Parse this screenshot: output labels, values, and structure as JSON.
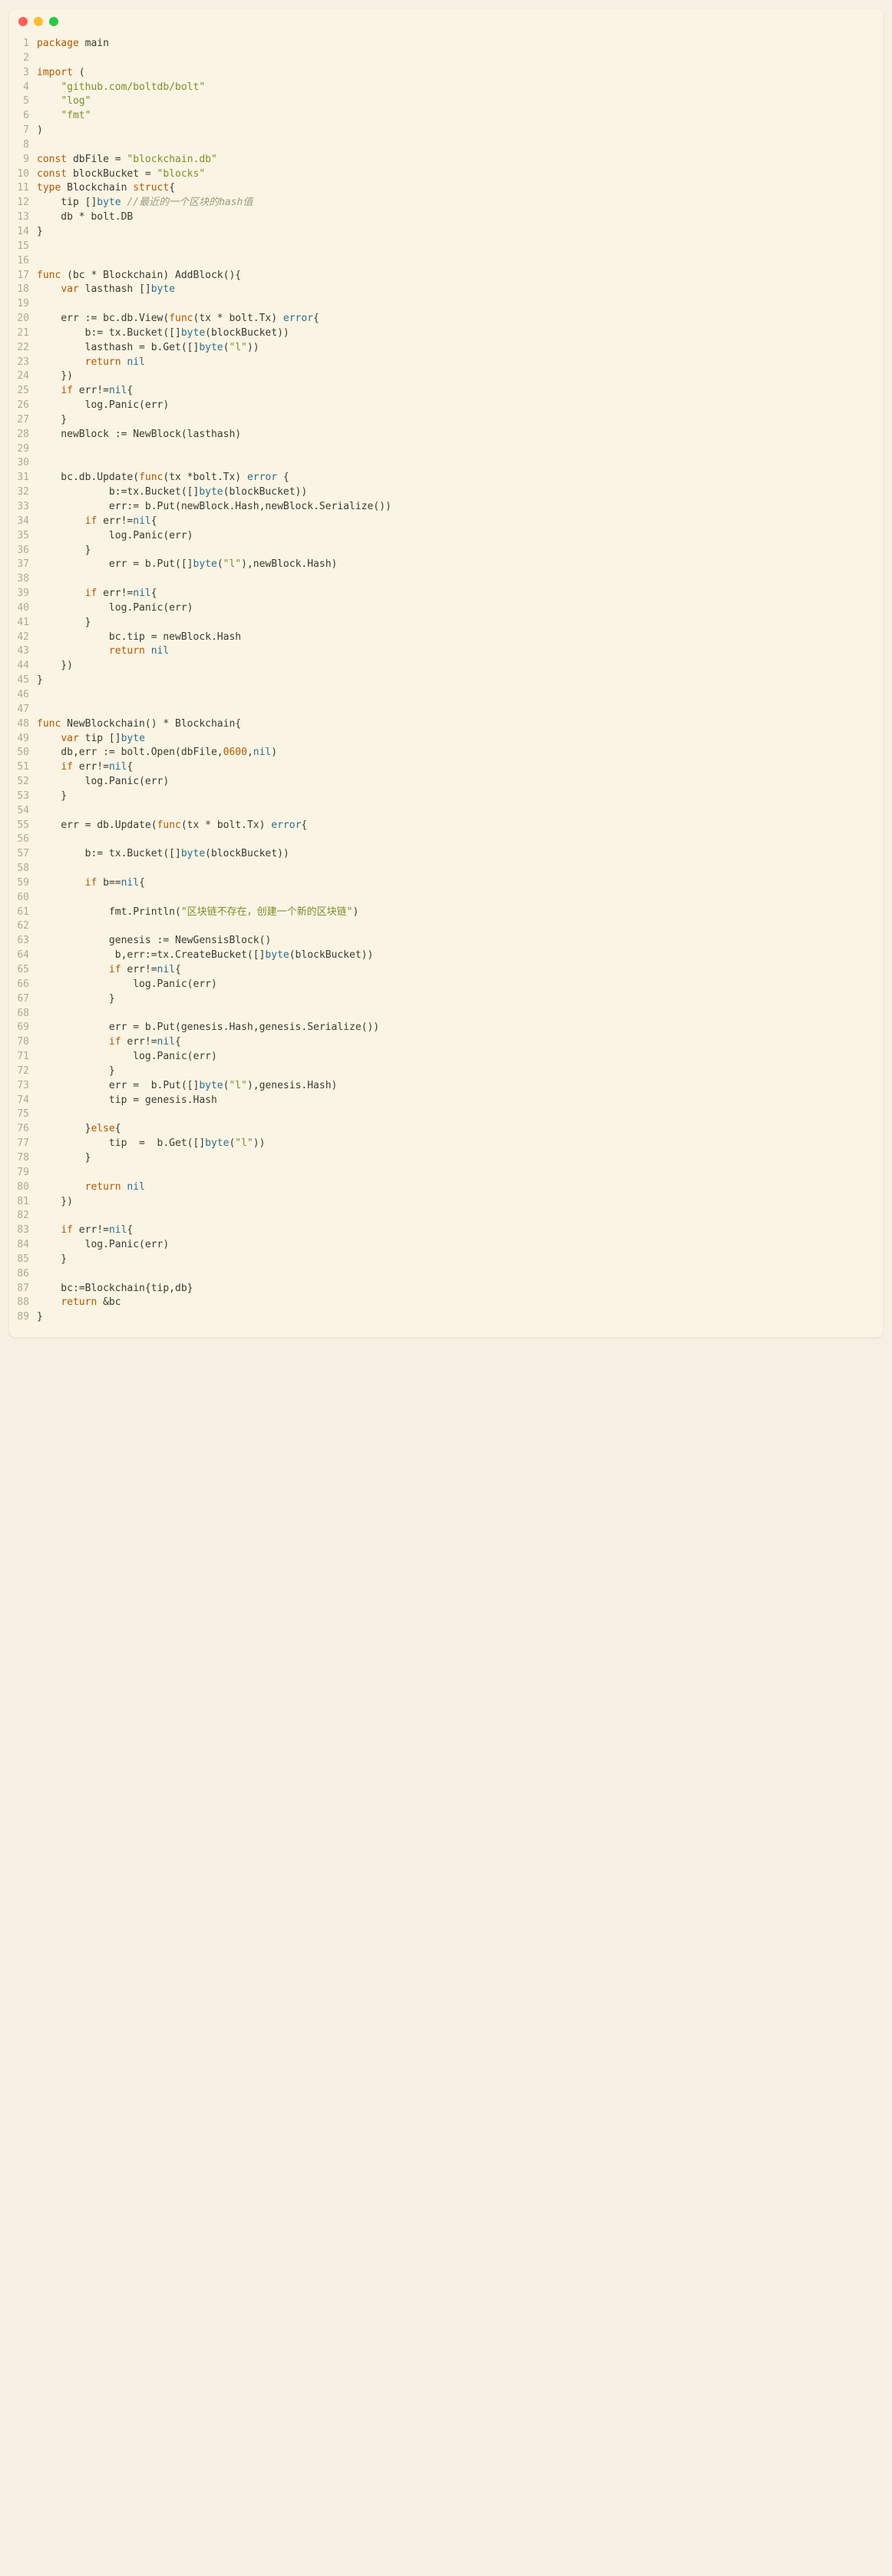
{
  "window": {
    "dots": [
      "red",
      "yellow",
      "green"
    ]
  },
  "code": {
    "lines": [
      {
        "n": 1,
        "t": [
          [
            "kw",
            "package"
          ],
          [
            "id",
            " main"
          ]
        ]
      },
      {
        "n": 2,
        "t": [
          [
            "id",
            ""
          ]
        ]
      },
      {
        "n": 3,
        "t": [
          [
            "kw",
            "import"
          ],
          [
            "id",
            " ("
          ]
        ]
      },
      {
        "n": 4,
        "t": [
          [
            "id",
            "    "
          ],
          [
            "str",
            "\"github.com/boltdb/bolt\""
          ]
        ]
      },
      {
        "n": 5,
        "t": [
          [
            "id",
            "    "
          ],
          [
            "str",
            "\"log\""
          ]
        ]
      },
      {
        "n": 6,
        "t": [
          [
            "id",
            "    "
          ],
          [
            "str",
            "\"fmt\""
          ]
        ]
      },
      {
        "n": 7,
        "t": [
          [
            "id",
            ")"
          ]
        ]
      },
      {
        "n": 8,
        "t": [
          [
            "id",
            ""
          ]
        ]
      },
      {
        "n": 9,
        "t": [
          [
            "kw",
            "const"
          ],
          [
            "id",
            " dbFile = "
          ],
          [
            "str",
            "\"blockchain.db\""
          ]
        ]
      },
      {
        "n": 10,
        "t": [
          [
            "kw",
            "const"
          ],
          [
            "id",
            " blockBucket = "
          ],
          [
            "str",
            "\"blocks\""
          ]
        ]
      },
      {
        "n": 11,
        "t": [
          [
            "kw",
            "type"
          ],
          [
            "id",
            " Blockchain "
          ],
          [
            "kw",
            "struct"
          ],
          [
            "id",
            "{"
          ]
        ]
      },
      {
        "n": 12,
        "t": [
          [
            "id",
            "    tip []"
          ],
          [
            "typ",
            "byte"
          ],
          [
            "id",
            " "
          ],
          [
            "cmt",
            "//最近的一个区块的hash值"
          ]
        ]
      },
      {
        "n": 13,
        "t": [
          [
            "id",
            "    db * bolt.DB"
          ]
        ]
      },
      {
        "n": 14,
        "t": [
          [
            "id",
            "}"
          ]
        ]
      },
      {
        "n": 15,
        "t": [
          [
            "id",
            ""
          ]
        ]
      },
      {
        "n": 16,
        "t": [
          [
            "id",
            ""
          ]
        ]
      },
      {
        "n": 17,
        "t": [
          [
            "kw",
            "func"
          ],
          [
            "id",
            " (bc * Blockchain) AddBlock(){"
          ]
        ]
      },
      {
        "n": 18,
        "t": [
          [
            "id",
            "    "
          ],
          [
            "kw",
            "var"
          ],
          [
            "id",
            " lasthash []"
          ],
          [
            "typ",
            "byte"
          ]
        ]
      },
      {
        "n": 19,
        "t": [
          [
            "id",
            ""
          ]
        ]
      },
      {
        "n": 20,
        "t": [
          [
            "id",
            "    err := bc.db.View("
          ],
          [
            "kw",
            "func"
          ],
          [
            "id",
            "(tx * bolt.Tx) "
          ],
          [
            "typ",
            "error"
          ],
          [
            "id",
            "{"
          ]
        ]
      },
      {
        "n": 21,
        "t": [
          [
            "id",
            "        b:= tx.Bucket([]"
          ],
          [
            "typ",
            "byte"
          ],
          [
            "id",
            "(blockBucket))"
          ]
        ]
      },
      {
        "n": 22,
        "t": [
          [
            "id",
            "        lasthash = b.Get([]"
          ],
          [
            "typ",
            "byte"
          ],
          [
            "id",
            "("
          ],
          [
            "str",
            "\"l\""
          ],
          [
            "id",
            "))"
          ]
        ]
      },
      {
        "n": 23,
        "t": [
          [
            "id",
            "        "
          ],
          [
            "kw",
            "return"
          ],
          [
            "id",
            " "
          ],
          [
            "typ",
            "nil"
          ]
        ]
      },
      {
        "n": 24,
        "t": [
          [
            "id",
            "    })"
          ]
        ]
      },
      {
        "n": 25,
        "t": [
          [
            "id",
            "    "
          ],
          [
            "kw",
            "if"
          ],
          [
            "id",
            " err!="
          ],
          [
            "typ",
            "nil"
          ],
          [
            "id",
            "{"
          ]
        ]
      },
      {
        "n": 26,
        "t": [
          [
            "id",
            "        log.Panic(err)"
          ]
        ]
      },
      {
        "n": 27,
        "t": [
          [
            "id",
            "    }"
          ]
        ]
      },
      {
        "n": 28,
        "t": [
          [
            "id",
            "    newBlock := NewBlock(lasthash)"
          ]
        ]
      },
      {
        "n": 29,
        "t": [
          [
            "id",
            ""
          ]
        ]
      },
      {
        "n": 30,
        "t": [
          [
            "id",
            ""
          ]
        ]
      },
      {
        "n": 31,
        "t": [
          [
            "id",
            "    bc.db.Update("
          ],
          [
            "kw",
            "func"
          ],
          [
            "id",
            "(tx *bolt.Tx) "
          ],
          [
            "typ",
            "error"
          ],
          [
            "id",
            " {"
          ]
        ]
      },
      {
        "n": 32,
        "t": [
          [
            "id",
            "            b:=tx.Bucket([]"
          ],
          [
            "typ",
            "byte"
          ],
          [
            "id",
            "(blockBucket))"
          ]
        ]
      },
      {
        "n": 33,
        "t": [
          [
            "id",
            "            err:= b.Put(newBlock.Hash,newBlock.Serialize())"
          ]
        ]
      },
      {
        "n": 34,
        "t": [
          [
            "id",
            "        "
          ],
          [
            "kw",
            "if"
          ],
          [
            "id",
            " err!="
          ],
          [
            "typ",
            "nil"
          ],
          [
            "id",
            "{"
          ]
        ]
      },
      {
        "n": 35,
        "t": [
          [
            "id",
            "            log.Panic(err)"
          ]
        ]
      },
      {
        "n": 36,
        "t": [
          [
            "id",
            "        }"
          ]
        ]
      },
      {
        "n": 37,
        "t": [
          [
            "id",
            "            err = b.Put([]"
          ],
          [
            "typ",
            "byte"
          ],
          [
            "id",
            "("
          ],
          [
            "str",
            "\"l\""
          ],
          [
            "id",
            "),newBlock.Hash)"
          ]
        ]
      },
      {
        "n": 38,
        "t": [
          [
            "id",
            ""
          ]
        ]
      },
      {
        "n": 39,
        "t": [
          [
            "id",
            "        "
          ],
          [
            "kw",
            "if"
          ],
          [
            "id",
            " err!="
          ],
          [
            "typ",
            "nil"
          ],
          [
            "id",
            "{"
          ]
        ]
      },
      {
        "n": 40,
        "t": [
          [
            "id",
            "            log.Panic(err)"
          ]
        ]
      },
      {
        "n": 41,
        "t": [
          [
            "id",
            "        }"
          ]
        ]
      },
      {
        "n": 42,
        "t": [
          [
            "id",
            "            bc.tip = newBlock.Hash"
          ]
        ]
      },
      {
        "n": 43,
        "t": [
          [
            "id",
            "            "
          ],
          [
            "kw",
            "return"
          ],
          [
            "id",
            " "
          ],
          [
            "typ",
            "nil"
          ]
        ]
      },
      {
        "n": 44,
        "t": [
          [
            "id",
            "    })"
          ]
        ]
      },
      {
        "n": 45,
        "t": [
          [
            "id",
            "}"
          ]
        ]
      },
      {
        "n": 46,
        "t": [
          [
            "id",
            ""
          ]
        ]
      },
      {
        "n": 47,
        "t": [
          [
            "id",
            ""
          ]
        ]
      },
      {
        "n": 48,
        "t": [
          [
            "kw",
            "func"
          ],
          [
            "id",
            " NewBlockchain() * Blockchain{"
          ]
        ]
      },
      {
        "n": 49,
        "t": [
          [
            "id",
            "    "
          ],
          [
            "kw",
            "var"
          ],
          [
            "id",
            " tip []"
          ],
          [
            "typ",
            "byte"
          ]
        ]
      },
      {
        "n": 50,
        "t": [
          [
            "id",
            "    db,err := bolt.Open(dbFile,"
          ],
          [
            "num",
            "0600"
          ],
          [
            "id",
            ","
          ],
          [
            "typ",
            "nil"
          ],
          [
            "id",
            ")"
          ]
        ]
      },
      {
        "n": 51,
        "t": [
          [
            "id",
            "    "
          ],
          [
            "kw",
            "if"
          ],
          [
            "id",
            " err!="
          ],
          [
            "typ",
            "nil"
          ],
          [
            "id",
            "{"
          ]
        ]
      },
      {
        "n": 52,
        "t": [
          [
            "id",
            "        log.Panic(err)"
          ]
        ]
      },
      {
        "n": 53,
        "t": [
          [
            "id",
            "    }"
          ]
        ]
      },
      {
        "n": 54,
        "t": [
          [
            "id",
            ""
          ]
        ]
      },
      {
        "n": 55,
        "t": [
          [
            "id",
            "    err = db.Update("
          ],
          [
            "kw",
            "func"
          ],
          [
            "id",
            "(tx * bolt.Tx) "
          ],
          [
            "typ",
            "error"
          ],
          [
            "id",
            "{"
          ]
        ]
      },
      {
        "n": 56,
        "t": [
          [
            "id",
            ""
          ]
        ]
      },
      {
        "n": 57,
        "t": [
          [
            "id",
            "        b:= tx.Bucket([]"
          ],
          [
            "typ",
            "byte"
          ],
          [
            "id",
            "(blockBucket))"
          ]
        ]
      },
      {
        "n": 58,
        "t": [
          [
            "id",
            ""
          ]
        ]
      },
      {
        "n": 59,
        "t": [
          [
            "id",
            "        "
          ],
          [
            "kw",
            "if"
          ],
          [
            "id",
            " b=="
          ],
          [
            "typ",
            "nil"
          ],
          [
            "id",
            "{"
          ]
        ]
      },
      {
        "n": 60,
        "t": [
          [
            "id",
            ""
          ]
        ]
      },
      {
        "n": 61,
        "t": [
          [
            "id",
            "            fmt.Println("
          ],
          [
            "str",
            "\"区块链不存在，创建一个新的区块链\""
          ],
          [
            "id",
            ")"
          ]
        ]
      },
      {
        "n": 62,
        "t": [
          [
            "id",
            ""
          ]
        ]
      },
      {
        "n": 63,
        "t": [
          [
            "id",
            "            genesis := NewGensisBlock()"
          ]
        ]
      },
      {
        "n": 64,
        "t": [
          [
            "id",
            "             b,err:=tx.CreateBucket([]"
          ],
          [
            "typ",
            "byte"
          ],
          [
            "id",
            "(blockBucket))"
          ]
        ]
      },
      {
        "n": 65,
        "t": [
          [
            "id",
            "            "
          ],
          [
            "kw",
            "if"
          ],
          [
            "id",
            " err!="
          ],
          [
            "typ",
            "nil"
          ],
          [
            "id",
            "{"
          ]
        ]
      },
      {
        "n": 66,
        "t": [
          [
            "id",
            "                log.Panic(err)"
          ]
        ]
      },
      {
        "n": 67,
        "t": [
          [
            "id",
            "            }"
          ]
        ]
      },
      {
        "n": 68,
        "t": [
          [
            "id",
            ""
          ]
        ]
      },
      {
        "n": 69,
        "t": [
          [
            "id",
            "            err = b.Put(genesis.Hash,genesis.Serialize())"
          ]
        ]
      },
      {
        "n": 70,
        "t": [
          [
            "id",
            "            "
          ],
          [
            "kw",
            "if"
          ],
          [
            "id",
            " err!="
          ],
          [
            "typ",
            "nil"
          ],
          [
            "id",
            "{"
          ]
        ]
      },
      {
        "n": 71,
        "t": [
          [
            "id",
            "                log.Panic(err)"
          ]
        ]
      },
      {
        "n": 72,
        "t": [
          [
            "id",
            "            }"
          ]
        ]
      },
      {
        "n": 73,
        "t": [
          [
            "id",
            "            err =  b.Put([]"
          ],
          [
            "typ",
            "byte"
          ],
          [
            "id",
            "("
          ],
          [
            "str",
            "\"l\""
          ],
          [
            "id",
            "),genesis.Hash)"
          ]
        ]
      },
      {
        "n": 74,
        "t": [
          [
            "id",
            "            tip = genesis.Hash"
          ]
        ]
      },
      {
        "n": 75,
        "t": [
          [
            "id",
            ""
          ]
        ]
      },
      {
        "n": 76,
        "t": [
          [
            "id",
            "        }"
          ],
          [
            "kw",
            "else"
          ],
          [
            "id",
            "{"
          ]
        ]
      },
      {
        "n": 77,
        "t": [
          [
            "id",
            "            tip  =  b.Get([]"
          ],
          [
            "typ",
            "byte"
          ],
          [
            "id",
            "("
          ],
          [
            "str",
            "\"l\""
          ],
          [
            "id",
            "))"
          ]
        ]
      },
      {
        "n": 78,
        "t": [
          [
            "id",
            "        }"
          ]
        ]
      },
      {
        "n": 79,
        "t": [
          [
            "id",
            ""
          ]
        ]
      },
      {
        "n": 80,
        "t": [
          [
            "id",
            "        "
          ],
          [
            "kw",
            "return"
          ],
          [
            "id",
            " "
          ],
          [
            "typ",
            "nil"
          ]
        ]
      },
      {
        "n": 81,
        "t": [
          [
            "id",
            "    })"
          ]
        ]
      },
      {
        "n": 82,
        "t": [
          [
            "id",
            ""
          ]
        ]
      },
      {
        "n": 83,
        "t": [
          [
            "id",
            "    "
          ],
          [
            "kw",
            "if"
          ],
          [
            "id",
            " err!="
          ],
          [
            "typ",
            "nil"
          ],
          [
            "id",
            "{"
          ]
        ]
      },
      {
        "n": 84,
        "t": [
          [
            "id",
            "        log.Panic(err)"
          ]
        ]
      },
      {
        "n": 85,
        "t": [
          [
            "id",
            "    }"
          ]
        ]
      },
      {
        "n": 86,
        "t": [
          [
            "id",
            ""
          ]
        ]
      },
      {
        "n": 87,
        "t": [
          [
            "id",
            "    bc:=Blockchain{tip,db}"
          ]
        ]
      },
      {
        "n": 88,
        "t": [
          [
            "id",
            "    "
          ],
          [
            "kw",
            "return"
          ],
          [
            "id",
            " &bc"
          ]
        ]
      },
      {
        "n": 89,
        "t": [
          [
            "id",
            "}"
          ]
        ]
      }
    ]
  }
}
